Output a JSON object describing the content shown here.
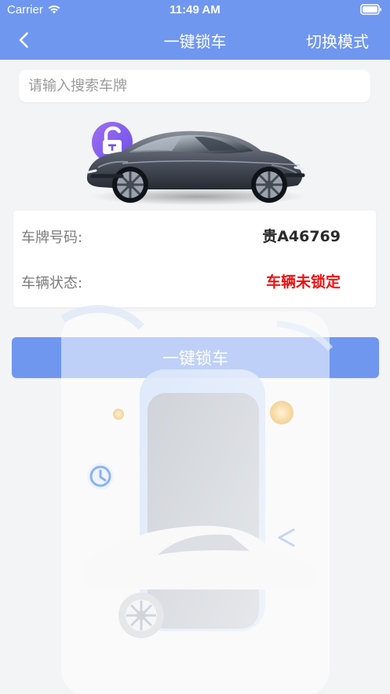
{
  "status_bar": {
    "carrier": "Carrier",
    "time": "11:49 AM",
    "wifi_icon": "wifi-icon",
    "battery_icon": "battery-icon"
  },
  "nav": {
    "back_icon": "chevron-left-icon",
    "title": "一键锁车",
    "right_action": "切换模式"
  },
  "search": {
    "placeholder": "请输入搜索车牌",
    "value": ""
  },
  "vehicle": {
    "lock_icon": "unlocked-lock-icon",
    "car_icon": "car-illustration",
    "plate_label": "车牌号码:",
    "plate_value": "贵A46769",
    "status_label": "车辆状态:",
    "status_value": "车辆未锁定"
  },
  "actions": {
    "lock_button": "一键锁车"
  },
  "colors": {
    "primary": "#6f97ef",
    "status_unlocked": "#ef1111",
    "background": "#f3f4f6",
    "card": "#ffffff"
  }
}
